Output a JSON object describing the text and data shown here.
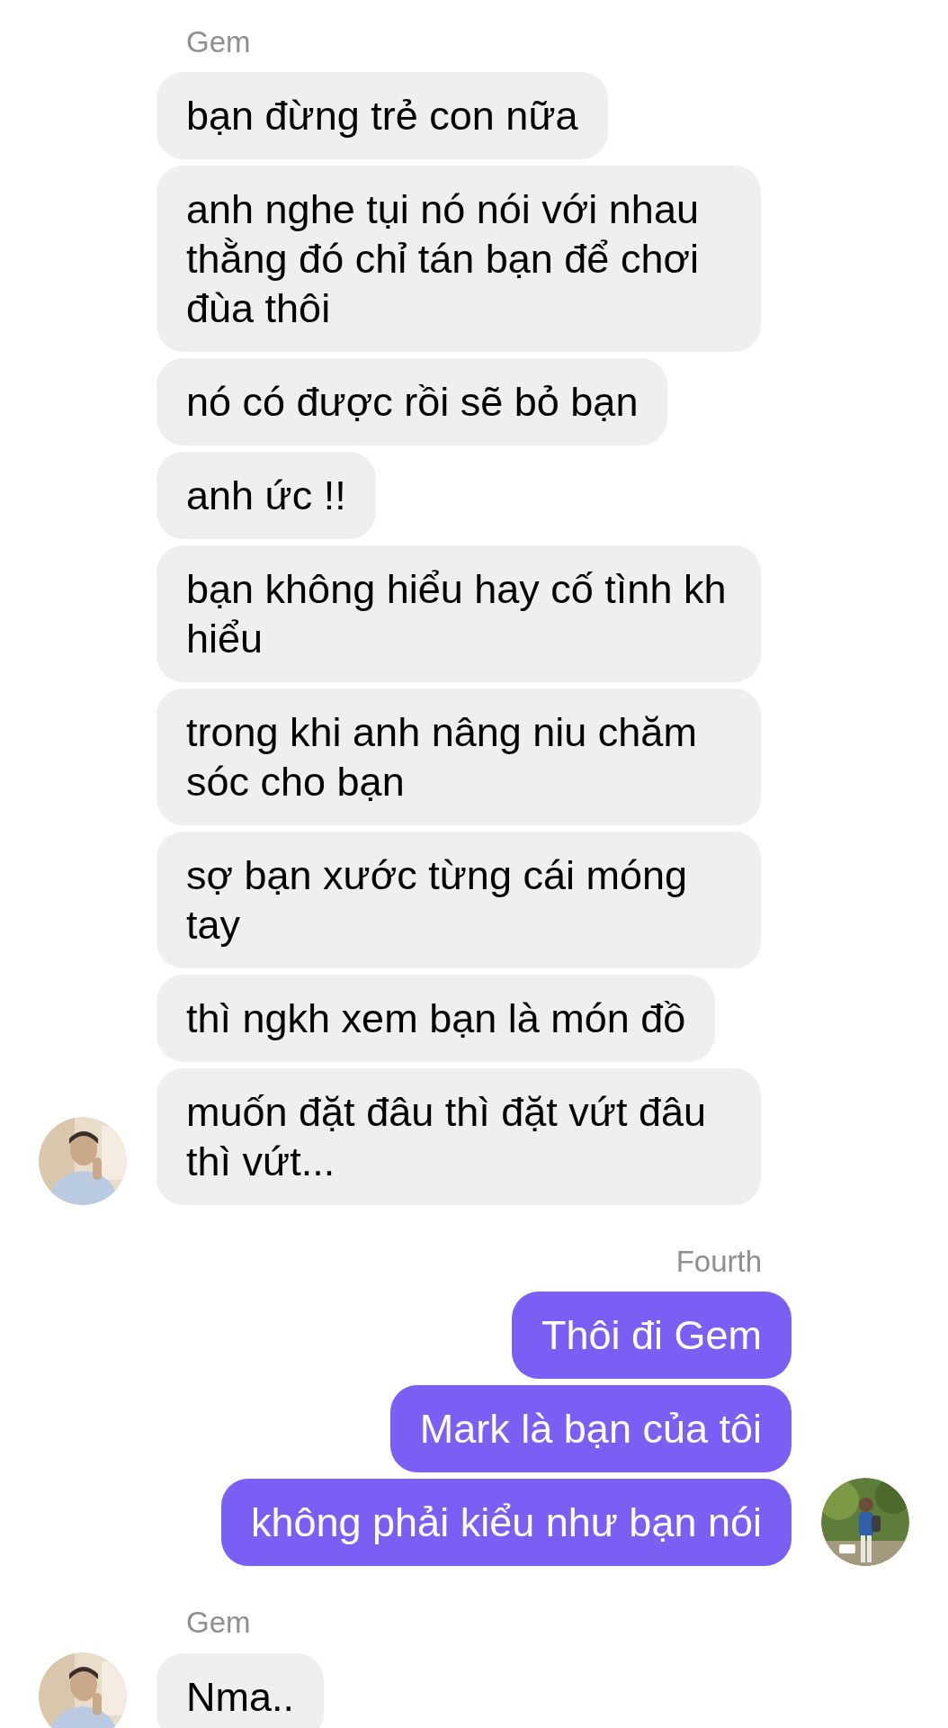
{
  "groups": [
    {
      "sender": "Gem",
      "kind": "incoming",
      "messages": [
        "bạn đừng trẻ con nữa",
        "anh nghe tụi nó nói với nhau thằng đó chỉ tán bạn để chơi đùa thôi",
        "nó có được rồi sẽ bỏ bạn",
        "anh ức !!",
        "bạn không hiểu hay cố tình kh hiểu",
        "trong khi anh nâng niu chăm sóc cho bạn",
        "sợ bạn xước từng cái móng tay",
        "thì ngkh xem bạn là món đồ",
        "muốn đặt đâu thì đặt vứt đâu thì vứt..."
      ]
    },
    {
      "sender": "Fourth",
      "kind": "outgoing",
      "messages": [
        "Thôi đi Gem",
        "Mark là bạn của tôi",
        "không phải kiểu như bạn nói"
      ]
    },
    {
      "sender": "Gem",
      "kind": "incoming",
      "messages": [
        "Nma.."
      ]
    }
  ]
}
